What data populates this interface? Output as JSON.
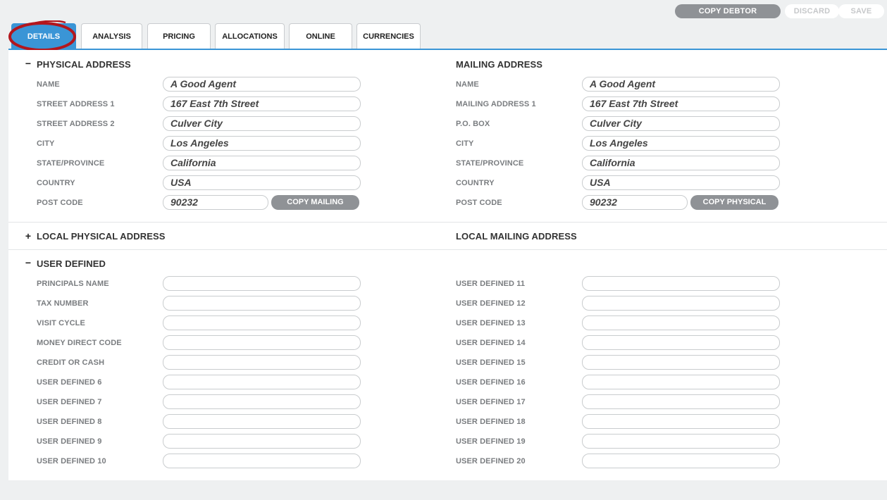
{
  "actions": {
    "copy_debtor": "COPY DEBTOR",
    "discard": "DISCARD",
    "save": "SAVE"
  },
  "tabs": [
    "DETAILS",
    "ANALYSIS",
    "PRICING",
    "ALLOCATIONS",
    "ONLINE",
    "CURRENCIES"
  ],
  "active_tab": "DETAILS",
  "physical": {
    "title": "PHYSICAL ADDRESS",
    "toggle": "−",
    "labels": [
      "NAME",
      "STREET ADDRESS 1",
      "STREET ADDRESS 2",
      "CITY",
      "STATE/PROVINCE",
      "COUNTRY",
      "POST CODE"
    ],
    "values": [
      "A Good Agent",
      "167 East 7th Street",
      "Culver City",
      "Los Angeles",
      "California",
      "USA",
      "90232"
    ],
    "copy_button": "COPY MAILING"
  },
  "mailing": {
    "title": "MAILING ADDRESS",
    "labels": [
      "NAME",
      "MAILING ADDRESS 1",
      "P.O. BOX",
      "CITY",
      "STATE/PROVINCE",
      "COUNTRY",
      "POST CODE"
    ],
    "values": [
      "A Good Agent",
      "167 East 7th Street",
      "Culver City",
      "Los Angeles",
      "California",
      "USA",
      "90232"
    ],
    "copy_button": "COPY PHYSICAL"
  },
  "local_physical": {
    "title": "LOCAL PHYSICAL ADDRESS",
    "toggle": "+"
  },
  "local_mailing": {
    "title": "LOCAL MAILING ADDRESS"
  },
  "user_defined": {
    "title": "USER DEFINED",
    "toggle": "−",
    "left_labels": [
      "PRINCIPALS NAME",
      "TAX NUMBER",
      "VISIT CYCLE",
      "MONEY DIRECT CODE",
      "CREDIT OR CASH",
      "USER DEFINED 6",
      "USER DEFINED 7",
      "USER DEFINED 8",
      "USER DEFINED 9",
      "USER DEFINED 10"
    ],
    "right_labels": [
      "USER DEFINED 11",
      "USER DEFINED 12",
      "USER DEFINED 13",
      "USER DEFINED 14",
      "USER DEFINED 15",
      "USER DEFINED 16",
      "USER DEFINED 17",
      "USER DEFINED 18",
      "USER DEFINED 19",
      "USER DEFINED 20"
    ]
  },
  "colors": {
    "accent": "#3a95d6",
    "gray_button": "#8f9296",
    "annotation": "#b3161d"
  }
}
